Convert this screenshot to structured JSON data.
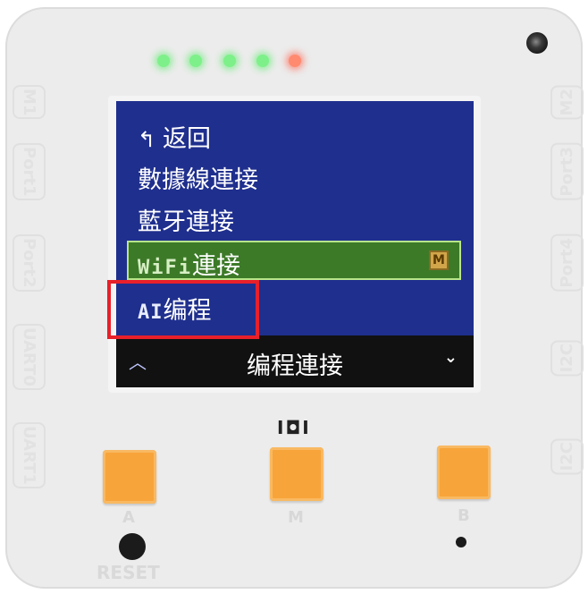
{
  "device": {
    "side_labels_left": [
      "M1",
      "Port1",
      "Port2",
      "UART0",
      "UART1"
    ],
    "side_labels_right": [
      "M2",
      "Port3",
      "Port4",
      "I2C",
      "I2C"
    ],
    "leds": [
      "green",
      "green",
      "green",
      "green",
      "red"
    ],
    "buttons": {
      "a": "A",
      "m": "M",
      "b": "B"
    },
    "reset_label": "RESET",
    "mic_label": "I◘I"
  },
  "menu": {
    "back": "返回",
    "items": [
      "數據線連接",
      "藍牙連接"
    ],
    "selected": {
      "prefix": "WiFi",
      "label": "連接"
    },
    "ai_item": {
      "prefix": "AI",
      "label": "编程"
    },
    "footer_title": "编程連接",
    "up_arrow": "︿",
    "down_arrow": "⌄",
    "lock_badge": "M"
  },
  "colors": {
    "screen_bg": "#1f2f8e",
    "selected_bg": "#3c7a28",
    "highlight": "#e8202a",
    "button": "#f7a43a"
  }
}
